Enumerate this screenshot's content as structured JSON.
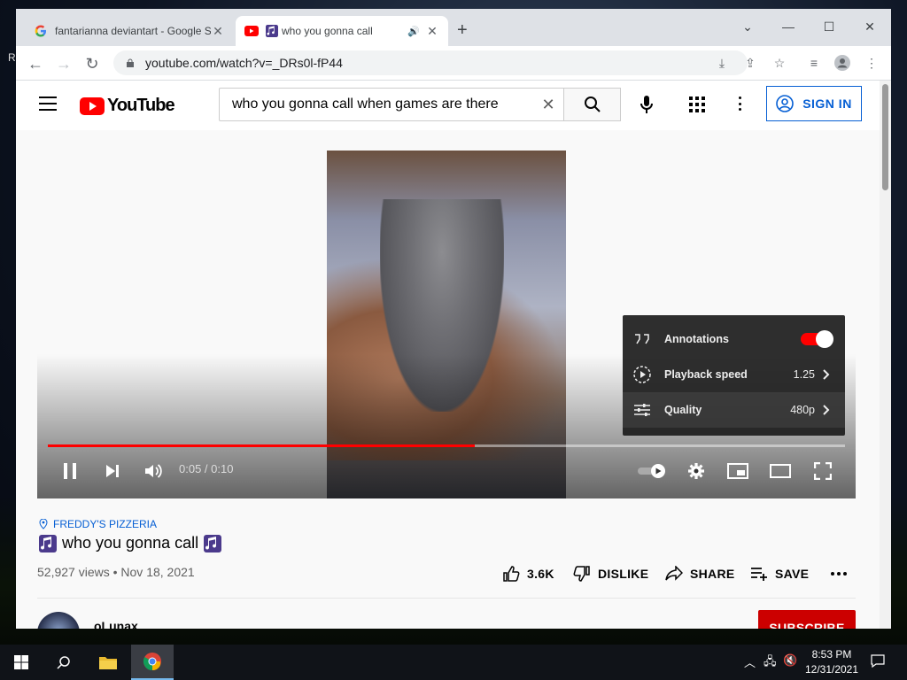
{
  "desktop": {
    "partial_icon_label": "R"
  },
  "browser": {
    "tabs": [
      {
        "title": "fantarianna deviantart - Google S",
        "favicon": "google-icon",
        "active": false
      },
      {
        "title": "who you gonna call",
        "favicon": "youtube-icon",
        "active": true,
        "audio": true
      }
    ],
    "url": "youtube.com/watch?v=_DRs0l-fP44"
  },
  "youtube": {
    "header": {
      "search_value": "who you gonna call when games are there",
      "search_placeholder": "Search",
      "sign_in_label": "SIGN IN",
      "logo_text": "YouTube"
    },
    "player": {
      "time": "0:05 / 0:10",
      "progress_fraction": 0.535,
      "settings_menu": [
        {
          "label": "Annotations",
          "icon": "annotations-icon",
          "toggle_on": true
        },
        {
          "label": "Playback speed",
          "icon": "playback-speed-icon",
          "value": "1.25"
        },
        {
          "label": "Quality",
          "icon": "quality-icon",
          "value": "480p"
        }
      ]
    },
    "video": {
      "location": "FREDDY'S PIZZERIA",
      "title": "who you gonna call",
      "views": "52,927 views",
      "date": "Nov 18, 2021",
      "likes": "3.6K",
      "dislike_label": "DISLIKE",
      "share_label": "SHARE",
      "save_label": "SAVE"
    },
    "channel": {
      "name": "oLunax",
      "subscribe_label": "SUBSCRIBE"
    }
  },
  "taskbar": {
    "time": "8:53 PM",
    "date": "12/31/2021"
  },
  "colors": {
    "yt_red": "#ff0000",
    "link_blue": "#065fd4",
    "subscribe_red": "#cc0000"
  }
}
